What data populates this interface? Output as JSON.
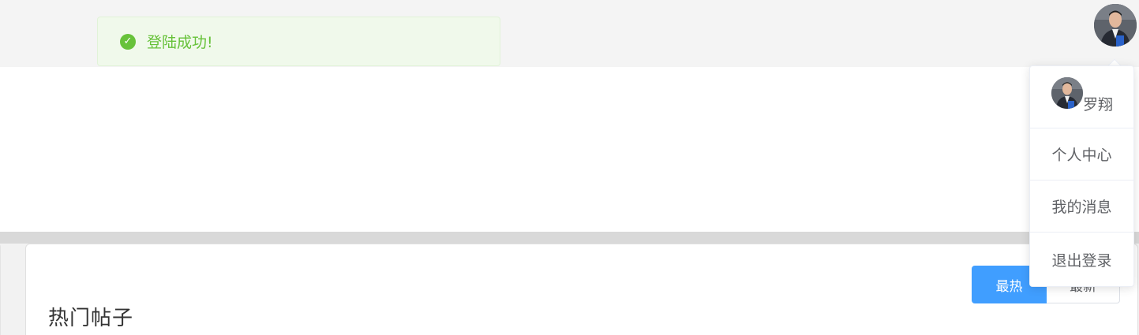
{
  "toast": {
    "icon": "check-circle-icon",
    "message": "登陆成功!",
    "color": "#67c23a"
  },
  "header": {
    "avatar": "user-avatar"
  },
  "dropdown": {
    "username": "罗翔",
    "items": [
      {
        "label": "个人中心"
      },
      {
        "label": "我的消息"
      },
      {
        "label": "退出登录"
      }
    ]
  },
  "main": {
    "section_title": "热门帖子",
    "sort_buttons": [
      {
        "label": "最热",
        "active": true
      },
      {
        "label": "最新",
        "active": false
      }
    ],
    "accent_color": "#409eff"
  }
}
